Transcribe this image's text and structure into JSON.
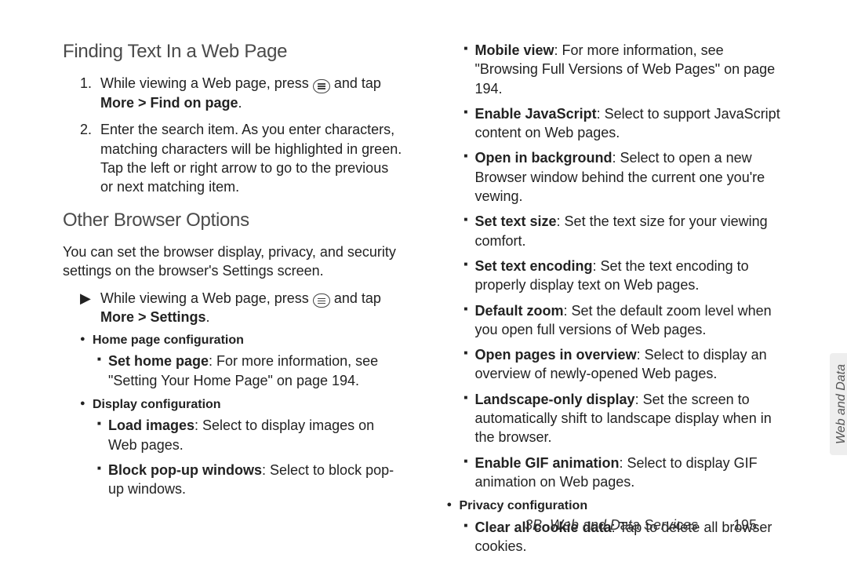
{
  "leftCol": {
    "h1": "Finding Text In a Web Page",
    "step1_num": "1.",
    "step1_a": "While viewing a Web page, press ",
    "step1_b": " and tap ",
    "step1_bold": "More > Find on page",
    "step1_c": ".",
    "step2_num": "2.",
    "step2": "Enter the search item. As you enter characters, matching characters will be highlighted in green. Tap the left or right arrow to go to the previous or next matching item.",
    "h2": "Other Browser Options",
    "intro": "You can set the browser display, privacy, and security settings on the browser's Settings screen.",
    "arrow_glyph": "▶",
    "arrow_a": "While viewing a Web page, press ",
    "arrow_b": " and tap ",
    "arrow_bold": "More > Settings",
    "arrow_c": ".",
    "sub1": "Home page configuration",
    "sub1_item1_b": "Set home page",
    "sub1_item1_t": ": For more information, see \"Setting Your Home Page\" on page 194.",
    "sub2": "Display configuration",
    "sub2_item1_b": "Load images",
    "sub2_item1_t": ": Select to display images on Web pages.",
    "sub2_item2_b": "Block pop-up windows",
    "sub2_item2_t": ": Select to block pop-up windows."
  },
  "rightCol": {
    "i1_b": "Mobile view",
    "i1_t": ": For more information, see \"Browsing Full Versions of Web Pages\" on page 194.",
    "i2_b": "Enable JavaScript",
    "i2_t": ": Select to support JavaScript content on Web pages.",
    "i3_b": "Open in background",
    "i3_t": ": Select to open a new Browser window behind the current one you're vewing.",
    "i4_b": "Set text size",
    "i4_t": ": Set the text size for your viewing comfort.",
    "i5_b": "Set text encoding",
    "i5_t": ": Set the text encoding to properly display text on Web pages.",
    "i6_b": "Default zoom",
    "i6_t": ": Set the default zoom level when you open full versions of Web pages.",
    "i7_b": "Open pages in overview",
    "i7_t": ": Select to display an overview of newly-opened Web pages.",
    "i8_b": "Landscape-only display",
    "i8_t": ": Set the screen to automatically shift to landscape display when in the browser.",
    "i9_b": "Enable GIF animation",
    "i9_t": ": Select to display GIF animation on Web pages.",
    "sub3": "Privacy configuration",
    "i10_b": "Clear all cookie data",
    "i10_t": ": Tap to delete all browser cookies."
  },
  "footer": {
    "section": "3B. Web and Data Services",
    "page": "195"
  },
  "sideTab": "Web and Data"
}
